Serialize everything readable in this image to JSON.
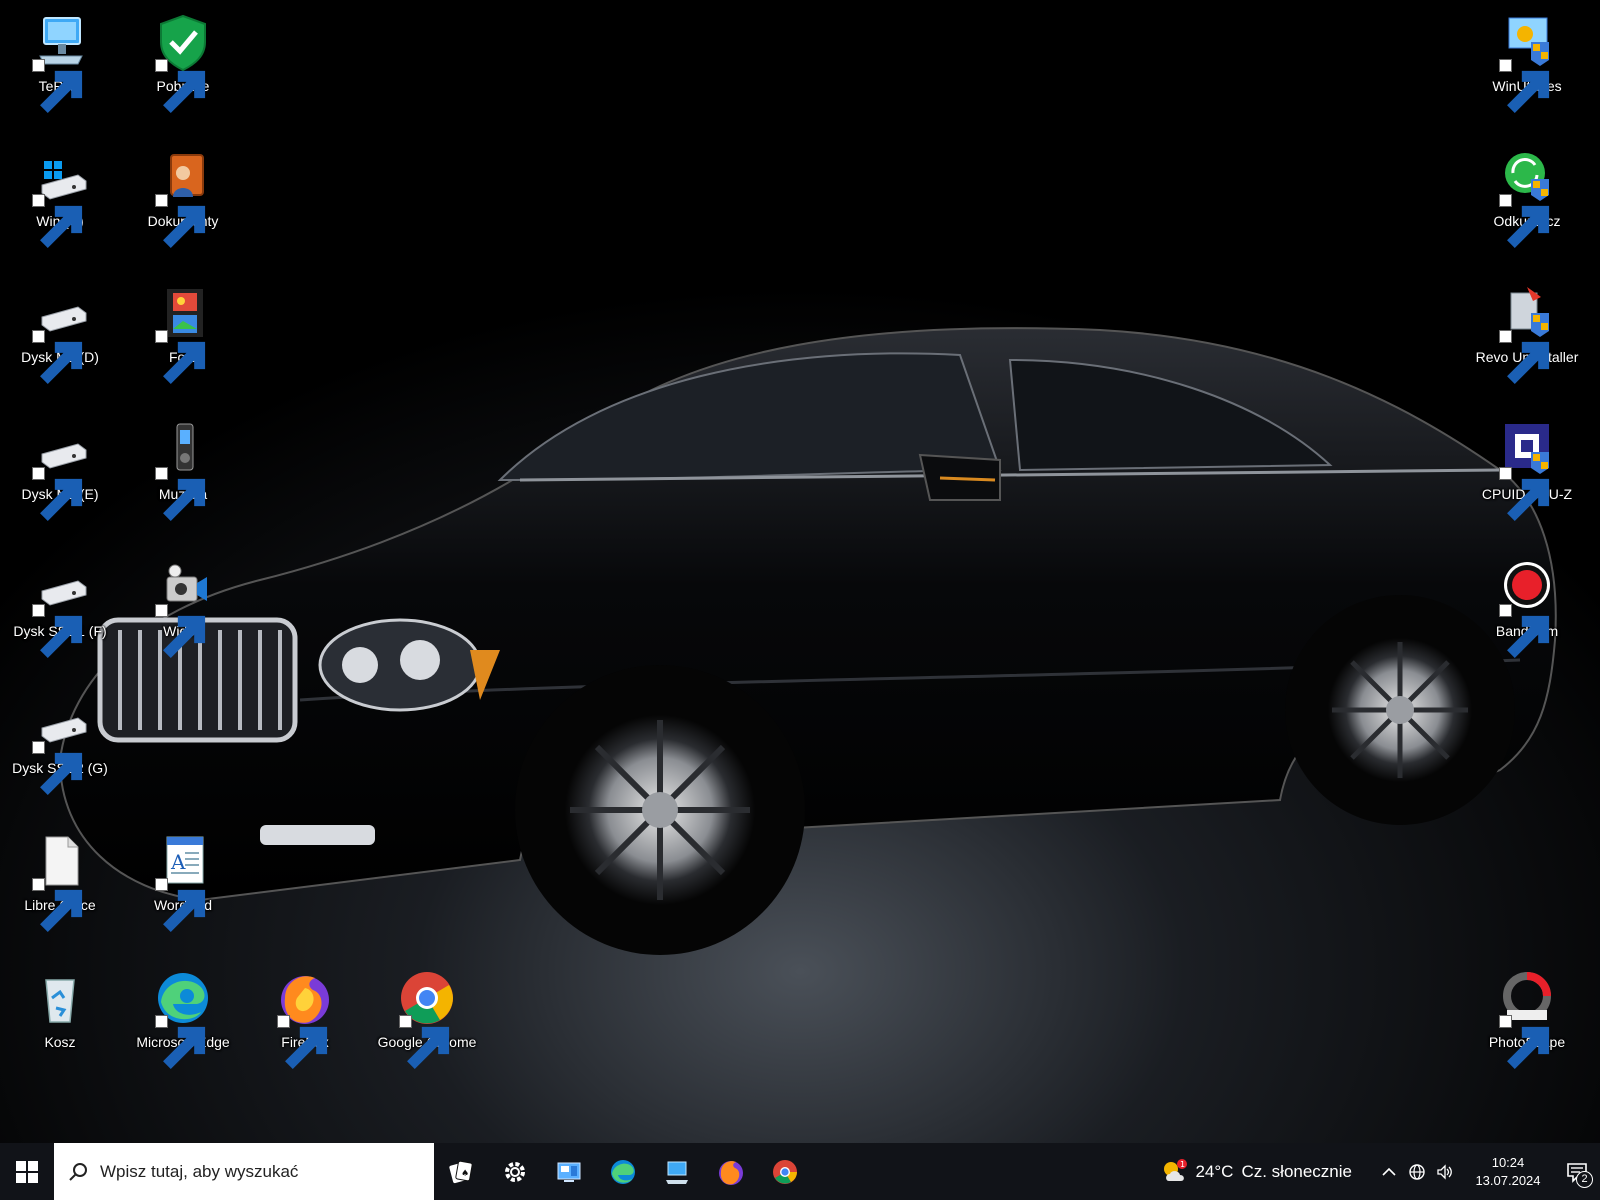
{
  "desktop": {
    "icons": {
      "terra": "TeRRa",
      "pobrane": "Pobrane",
      "win_c": "Win (C)",
      "dokumenty": "Dokumenty",
      "dysk_m2_d": "Dysk M2 (D)",
      "foto": "Foto",
      "dysk_m2_e": "Dysk M2 (E)",
      "muzyka": "Muzyka",
      "dysk_ssd1_f": "Dysk SSD1 (F)",
      "wideo": "Wideo",
      "dysk_ssd2_g": "Dysk SSD2 (G)",
      "libre_office": "Libre Office",
      "wordpad": "WordPad",
      "kosz": "Kosz",
      "microsoft_edge": "Microsoft Edge",
      "firefox": "FireFox",
      "google_chrome": "Google Chrome",
      "winutilities": "WinUtilities",
      "odkurzacz": "Odkurzacz",
      "revo_uninstaller": "Revo Uninstaller",
      "cpuid_cpu_z": "CPUID CPU-Z",
      "bandicam": "Bandicam",
      "photoscape": "PhotoScape"
    }
  },
  "taskbar": {
    "search_placeholder": "Wpisz tutaj, aby wyszukać",
    "apps": [
      "solitaire-icon",
      "settings-icon",
      "control-panel-icon",
      "edge-icon",
      "this-pc-icon",
      "firefox-icon",
      "chrome-icon"
    ],
    "weather": {
      "temperature": "24°C",
      "condition": "Cz. słonecznie",
      "alert_badge": "1"
    },
    "clock": {
      "time": "10:24",
      "date": "13.07.2024"
    },
    "notification_count": "2"
  },
  "colors": {
    "taskbar_bg": "#111318",
    "windows_blue": "#0078d7",
    "bandicam_red": "#e8202a"
  }
}
